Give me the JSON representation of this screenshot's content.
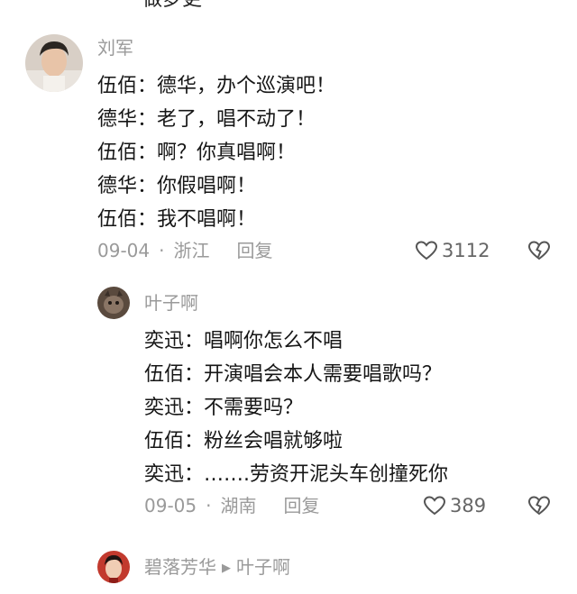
{
  "top_clip_text": "做梦更",
  "comments": [
    {
      "username": "刘军",
      "lines": [
        "伍佰：德华，办个巡演吧！",
        "德华：老了，唱不动了！",
        "伍佰：啊？你真唱啊！",
        "德华：你假唱啊！",
        "伍佰：我不唱啊！"
      ],
      "date": "09-04",
      "location": "浙江",
      "reply_label": "回复",
      "likes": "3112"
    },
    {
      "username": "叶子啊",
      "lines": [
        "奕迅：唱啊你怎么不唱",
        "伍佰：开演唱会本人需要唱歌吗？",
        "奕迅：不需要吗？",
        "伍佰：粉丝会唱就够啦",
        "奕迅：…….劳资开泥头车创撞死你"
      ],
      "date": "09-05",
      "location": "湖南",
      "reply_label": "回复",
      "likes": "389"
    },
    {
      "username": "碧落芳华",
      "reply_to": "叶子啊"
    }
  ],
  "icons": {
    "like": "heart-outline-icon",
    "dislike": "broken-heart-icon",
    "reply_arrow": "triangle-right-icon"
  }
}
